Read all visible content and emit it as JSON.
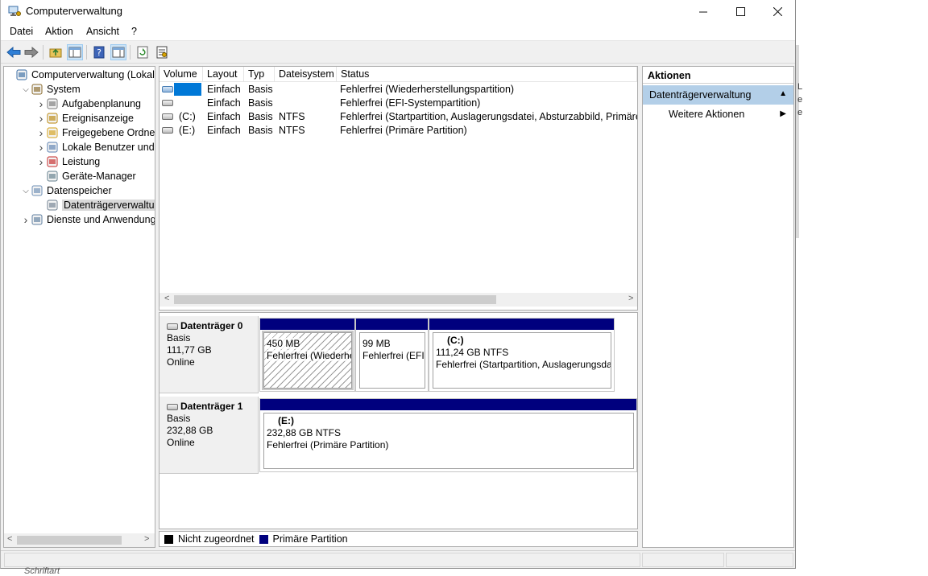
{
  "window": {
    "title": "Computerverwaltung"
  },
  "menu": [
    "Datei",
    "Aktion",
    "Ansicht",
    "?"
  ],
  "tree": {
    "items": [
      {
        "label": "Computerverwaltung (Lokal)",
        "level": 0,
        "expander": "",
        "icon": "computer-management-icon"
      },
      {
        "label": "System",
        "level": 1,
        "expander": "open",
        "icon": "tools-icon"
      },
      {
        "label": "Aufgabenplanung",
        "level": 2,
        "expander": "closed",
        "icon": "clock-icon"
      },
      {
        "label": "Ereignisanzeige",
        "level": 2,
        "expander": "closed",
        "icon": "event-viewer-icon"
      },
      {
        "label": "Freigegebene Ordner",
        "level": 2,
        "expander": "closed",
        "icon": "shared-folder-icon"
      },
      {
        "label": "Lokale Benutzer und Gruppen",
        "level": 2,
        "expander": "closed",
        "icon": "users-icon"
      },
      {
        "label": "Leistung",
        "level": 2,
        "expander": "closed",
        "icon": "performance-icon"
      },
      {
        "label": "Geräte-Manager",
        "level": 2,
        "expander": "",
        "icon": "device-manager-icon"
      },
      {
        "label": "Datenspeicher",
        "level": 1,
        "expander": "open",
        "icon": "storage-icon"
      },
      {
        "label": "Datenträgerverwaltung",
        "level": 2,
        "expander": "",
        "icon": "disk-management-icon",
        "selected": true
      },
      {
        "label": "Dienste und Anwendungen",
        "level": 1,
        "expander": "closed",
        "icon": "services-icon"
      }
    ]
  },
  "volume_table": {
    "columns": [
      "Volume",
      "Layout",
      "Typ",
      "Dateisystem",
      "Status"
    ],
    "rows": [
      {
        "volume": "",
        "layout": "Einfach",
        "type": "Basis",
        "fs": "",
        "status": "Fehlerfrei (Wiederherstellungspartition)",
        "selected": true
      },
      {
        "volume": "",
        "layout": "Einfach",
        "type": "Basis",
        "fs": "",
        "status": "Fehlerfrei (EFI-Systempartition)"
      },
      {
        "volume": "(C:)",
        "layout": "Einfach",
        "type": "Basis",
        "fs": "NTFS",
        "status": "Fehlerfrei (Startpartition, Auslagerungsdatei, Absturzabbild, Primäre Pa"
      },
      {
        "volume": "(E:)",
        "layout": "Einfach",
        "type": "Basis",
        "fs": "NTFS",
        "status": "Fehlerfrei (Primäre Partition)"
      }
    ]
  },
  "disks": [
    {
      "name": "Datenträger 0",
      "type": "Basis",
      "size": "111,77 GB",
      "state": "Online",
      "partitions": [
        {
          "label": "",
          "size": "450 MB",
          "status": "Fehlerfrei (Wiederherstellungspartition)",
          "hatched": true
        },
        {
          "label": "",
          "size": "99 MB",
          "status": "Fehlerfrei (EFI-Systempartition)"
        },
        {
          "label": "(C:)",
          "size": "111,24 GB NTFS",
          "status": "Fehlerfrei (Startpartition, Auslagerungsdatei"
        }
      ]
    },
    {
      "name": "Datenträger 1",
      "type": "Basis",
      "size": "232,88 GB",
      "state": "Online",
      "partitions": [
        {
          "label": "(E:)",
          "size": "232,88 GB NTFS",
          "status": "Fehlerfrei (Primäre Partition)"
        }
      ]
    }
  ],
  "legend": [
    {
      "label": "Nicht zugeordnet",
      "color": "#000000"
    },
    {
      "label": "Primäre Partition",
      "color": "#00007e"
    }
  ],
  "actions": {
    "header": "Aktionen",
    "section": "Datenträgerverwaltung",
    "item": "Weitere Aktionen"
  },
  "background": {
    "right_fragments": [
      "L",
      "e",
      "e"
    ],
    "bottom_fragment": "Schriftart"
  },
  "colors": {
    "primary_partition": "#00007e",
    "selection": "#0078d7",
    "actions_section": "#b3cfe8"
  }
}
